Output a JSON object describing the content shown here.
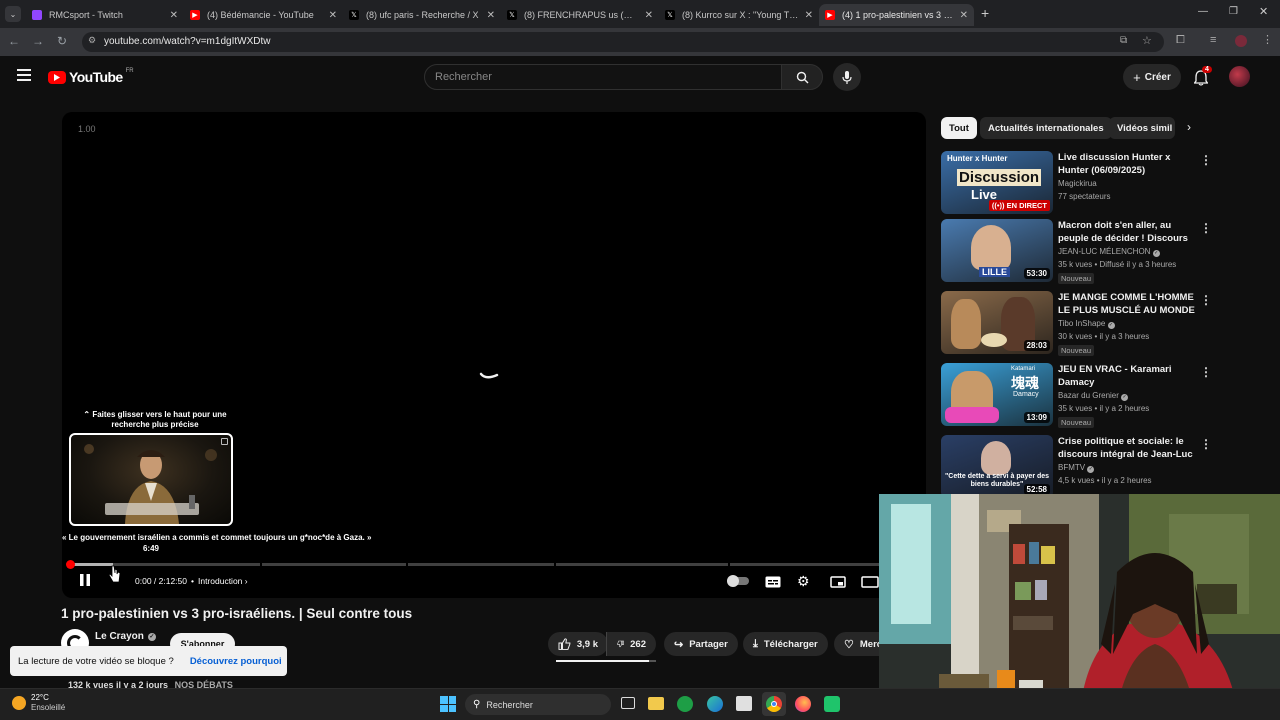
{
  "browser": {
    "tabs": [
      {
        "title": "RMCsport - Twitch",
        "icon": "twitch-icon",
        "color": "#9146ff"
      },
      {
        "title": "(4) Bédémancie - YouTube",
        "icon": "youtube-icon",
        "color": "#ff0000"
      },
      {
        "title": "(8) ufc paris - Recherche / X",
        "icon": "x-icon",
        "color": "#000000"
      },
      {
        "title": "(8) FRENCHRAPUS us (@Frenchr",
        "icon": "x-icon",
        "color": "#000000"
      },
      {
        "title": "(8) Kurrco sur X : \"Young Thug",
        "icon": "x-icon",
        "color": "#000000"
      },
      {
        "title": "(4) 1 pro-palestinien vs 3 pro-is",
        "icon": "youtube-icon",
        "color": "#ff0000"
      }
    ],
    "url": "youtube.com/watch?v=m1dgItWXDtw"
  },
  "header": {
    "logo_text": "YouTube",
    "region": "FR",
    "search_placeholder": "Rechercher",
    "create_label": "Créer",
    "notif_count": "4"
  },
  "player": {
    "speed": "1.00",
    "seek_hint_line1": "Faites glisser vers le haut pour une",
    "seek_hint_line2": "recherche plus précise",
    "preview_chapter": "« Le gouvernement israélien a commis et commet toujours un g*noc*de à Gaza. »",
    "preview_time": "6:49",
    "time_current": "0:00",
    "time_total": "2:12:50",
    "time_display": "0:00 / 2:12:50",
    "chapter": "Introduction",
    "progress_fraction": 0.002,
    "hover_fraction": 0.056,
    "accent": "#ff0000"
  },
  "video": {
    "title": "1 pro-palestinien vs 3 pro-israéliens. | Seul contre tous",
    "channel": "Le Crayon",
    "subscribe_label": "S'abonner",
    "likes": "3,9 k",
    "dislikes": "262",
    "share_label": "Partager",
    "download_label": "Télécharger",
    "more_label": "Merc",
    "meta": "132 k vues  il y a 2 jours",
    "meta_tag": "NOS DÉBATS"
  },
  "toast": {
    "message": "La lecture de votre vidéo se bloque ?",
    "link": "Découvrez pourquoi"
  },
  "chips": [
    "Tout",
    "Actualités internationales",
    "Vidéos simil"
  ],
  "recommendations": [
    {
      "title": "Live discussion Hunter x Hunter (06/09/2025)",
      "channel": "Magickirua",
      "meta": "77 spectateurs",
      "live_label": "EN DIRECT",
      "thumb_text1": "Hunter x Hunter",
      "thumb_text2": "Discussion",
      "thumb_text3": "Live",
      "thumb_color": "#3a6ea8"
    },
    {
      "title": "Macron doit s'en aller, au peuple de décider ! Discours de Jean-...",
      "channel": "JEAN-LUC MÉLENCHON",
      "meta": "35 k vues • Diffusé il y a 3 heures",
      "badge": "Nouveau",
      "duration": "53:30",
      "thumb_text1": "LILLE",
      "thumb_color": "#4a7bb0"
    },
    {
      "title": "JE MANGE COMME L'HOMME LE PLUS MUSCLÉ AU MONDE ...",
      "channel": "Tibo InShape",
      "meta": "30 k vues • il y a 3 heures",
      "badge": "Nouveau",
      "duration": "28:03",
      "thumb_color": "#8a6a4a"
    },
    {
      "title": "JEU EN VRAC - Karamari Damacy",
      "channel": "Bazar du Grenier",
      "meta": "35 k vues • il y a 2 heures",
      "badge": "Nouveau",
      "duration": "13:09",
      "thumb_text1": "Katamari",
      "thumb_text2": "塊魂",
      "thumb_text3": "Damacy",
      "thumb_color": "#3aa0d8"
    },
    {
      "title": "Crise politique et sociale: le discours intégral de Jean-Luc ...",
      "channel": "BFMTV",
      "meta": "4,5 k vues • il y a 2 heures",
      "duration": "52:58",
      "thumb_text1": "\"Cette dette a servi à payer des biens durables\"",
      "thumb_color": "#2a3f66"
    }
  ],
  "taskbar": {
    "weather_temp": "22°C",
    "weather_desc": "Ensoleillé",
    "search_label": "Rechercher"
  }
}
